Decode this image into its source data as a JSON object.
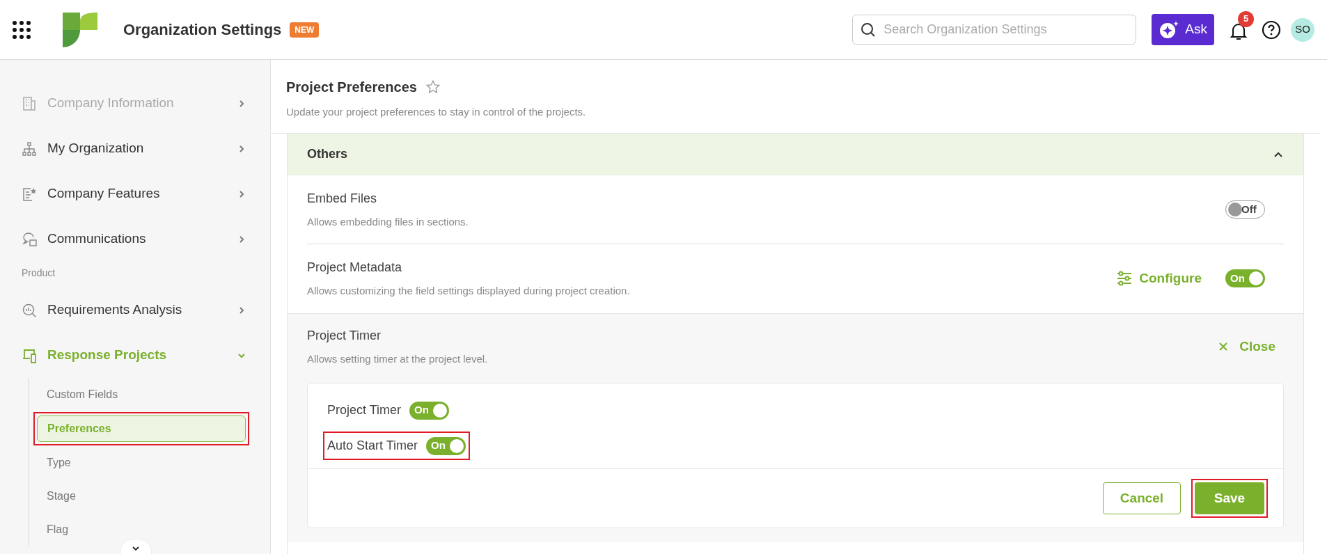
{
  "header": {
    "title": "Organization Settings",
    "badge": "NEW",
    "search": {
      "placeholder": "Search Organization Settings"
    },
    "ask_button": "Ask",
    "notification_count": "5",
    "avatar": "SO"
  },
  "sidebar": {
    "items": [
      {
        "kind": "item",
        "label": "Company Information",
        "selected": false
      },
      {
        "kind": "item",
        "label": "My Organization",
        "selected": false
      },
      {
        "kind": "item",
        "label": "Company Features",
        "selected": false
      },
      {
        "kind": "item",
        "label": "Communications",
        "selected": false
      },
      {
        "kind": "section",
        "label": "Product"
      },
      {
        "kind": "item",
        "label": "Requirements Analysis",
        "selected": false
      },
      {
        "kind": "item",
        "label": "Response Projects",
        "selected": true,
        "expanded": true,
        "children": [
          {
            "label": "Custom Fields",
            "selected": false,
            "highlighted": false
          },
          {
            "label": "Preferences",
            "selected": true,
            "highlighted": true
          },
          {
            "label": "Type",
            "selected": false,
            "highlighted": false
          },
          {
            "label": "Stage",
            "selected": false,
            "highlighted": false
          },
          {
            "label": "Flag",
            "selected": false,
            "highlighted": false
          }
        ]
      }
    ]
  },
  "page": {
    "title": "Project Preferences",
    "subtitle": "Update your project preferences to stay in control of the projects.",
    "section": {
      "title": "Others",
      "expanded": true,
      "settings": [
        {
          "kind": "toggle",
          "title": "Embed Files",
          "description": "Allows embedding files in sections.",
          "toggle": {
            "on": false,
            "label": "Off"
          }
        },
        {
          "kind": "configurable",
          "title": "Project Metadata",
          "description": "Allows customizing the field settings displayed during project creation.",
          "action": "Configure",
          "toggle": {
            "on": true,
            "label": "On"
          }
        },
        {
          "kind": "expanded",
          "title": "Project Timer",
          "description": "Allows setting timer at the project level.",
          "action": "Close",
          "options": [
            {
              "label": "Project Timer",
              "toggle": {
                "on": true,
                "label": "On"
              },
              "highlighted": false
            },
            {
              "label": "Auto Start Timer",
              "toggle": {
                "on": true,
                "label": "On"
              },
              "highlighted": true
            }
          ],
          "buttons": [
            {
              "kind": "secondary",
              "label": "Cancel",
              "highlighted": false
            },
            {
              "kind": "primary",
              "label": "Save",
              "highlighted": true
            }
          ]
        }
      ]
    }
  }
}
